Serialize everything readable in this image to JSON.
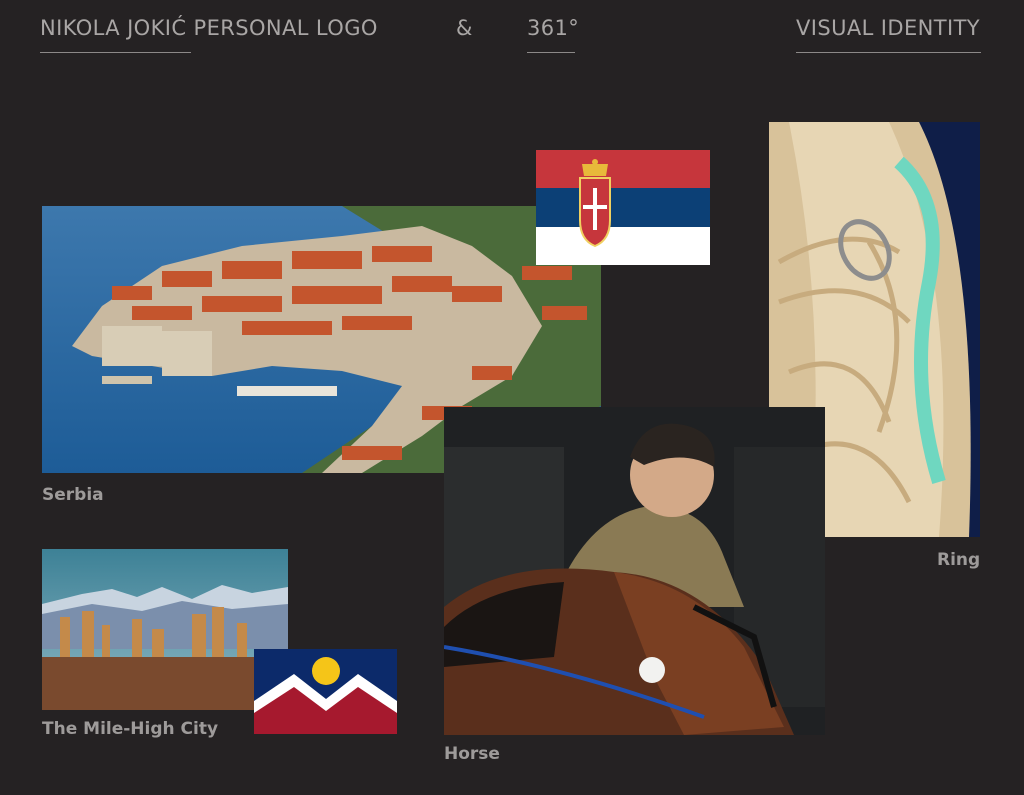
{
  "header": {
    "left_title": "NIKOLA JOKIĆ PERSONAL LOGO",
    "ampersand": "&",
    "degree": "361°",
    "right_title": "VISUAL IDENTITY"
  },
  "captions": {
    "serbia": "Serbia",
    "mile_high": "The Mile-High City",
    "horse": "Horse",
    "ring": "Ring"
  },
  "colors": {
    "background": "#252223",
    "header_text": "#a9a6a5",
    "caption_text": "#9e9b9a",
    "serbia_red": "#c6363c",
    "serbia_blue": "#0c4076",
    "denver_navy": "#0c2a6a",
    "denver_red": "#a6192e",
    "denver_gold": "#f5c518"
  },
  "images": {
    "dubrovnik": "photo of Dubrovnik old town and harbor",
    "serbia_flag": "flag of Serbia",
    "ring_shoe": "close-up of sneaker laces with a ring",
    "denver_skyline": "Denver skyline with mountains",
    "denver_flag": "flag of Denver",
    "horse_photo": "man with a horse"
  }
}
